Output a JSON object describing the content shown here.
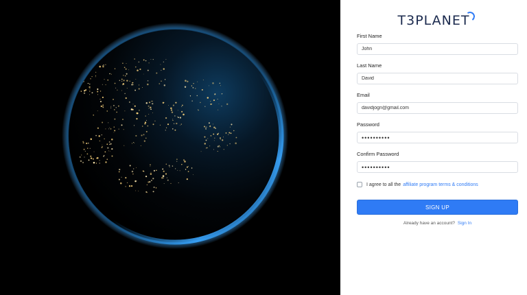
{
  "brand": {
    "name": "T3PLANET",
    "accent": "#2f7bf5"
  },
  "form": {
    "first_name": {
      "label": "First Name",
      "value": "John"
    },
    "last_name": {
      "label": "Last Name",
      "value": "David"
    },
    "email": {
      "label": "Email",
      "value": "davidjogn@gmail.com"
    },
    "password": {
      "label": "Password",
      "value": "••••••••••"
    },
    "confirm_password": {
      "label": "Confirm Password",
      "value": "••••••••••"
    },
    "agree": {
      "text": "I agree to all the",
      "link": "affiliate program terms & conditions"
    },
    "submit_label": "SIGN UP",
    "signin": {
      "prompt": "Already have an account?",
      "link": "Sign In"
    }
  },
  "hero": {
    "image": "earth-at-night"
  }
}
